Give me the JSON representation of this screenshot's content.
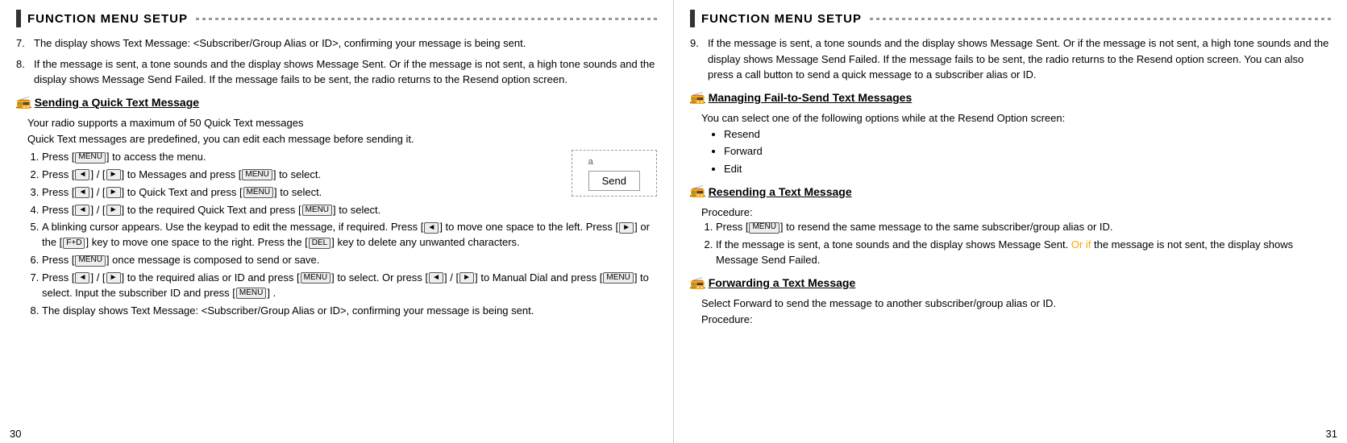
{
  "left_page": {
    "section_title": "FUNCTION MENU SETUP",
    "page_number": "30",
    "items_intro": [
      {
        "num": "7.",
        "text": "The display shows Text Message: <Subscriber/Group Alias or ID>, confirming your message is being sent."
      },
      {
        "num": "8.",
        "text": "If the message is sent, a tone sounds and the display shows Message Sent. Or if the message is not sent, a high tone sounds and the display shows Message Send Failed. If the message fails to be sent, the radio returns to the Resend option screen."
      }
    ],
    "subsection": {
      "title": "Sending a Quick Text Message",
      "intro1": "Your radio supports a maximum of 50 Quick Text messages",
      "intro2": "Quick Text messages are predefined, you can edit each message before sending it.",
      "steps": [
        "Press [MENU] to access the menu.",
        "Press [◄] / [►] to Messages and press [MENU] to select.",
        "Press [◄] / [►] to Quick Text and press [MENU] to select.",
        "Press [◄] / [►] to the required Quick Text and press [MENU] to select.",
        "A blinking cursor appears. Use the keypad to edit the message, if required. Press [◄] to move one space to the left. Press [►] or the [F+D] key to move one space to the right. Press the [DEL] key to delete any unwanted characters.",
        "Press [MENU] once message is composed to send or save.",
        "Press [◄] / [►] to the required alias or ID and press [MENU] to select. Or press [◄] / [►] to Manual Dial and press [MENU] to select. Input the subscriber ID and press [MENU].",
        "The display shows Text Message: <Subscriber/Group Alias or ID>, confirming your message is being sent."
      ],
      "send_box_label": "a",
      "send_box_text": "Send"
    }
  },
  "right_page": {
    "section_title": "FUNCTION MENU SETUP",
    "page_number": "31",
    "item_9": {
      "num": "9.",
      "text": "If the message is sent, a tone sounds and the display shows Message Sent. Or if the message is not sent, a high tone sounds and the display shows Message Send Failed. If the message fails to be sent, the radio returns to the Resend option screen. You can also press a call button to send a quick message to a subscriber alias or ID."
    },
    "subsections": [
      {
        "id": "managing",
        "title": "Managing Fail-to-Send Text Messages",
        "intro": "You can select one of the following options while at the Resend Option screen:",
        "bullets": [
          "Resend",
          "Forward",
          "Edit"
        ]
      },
      {
        "id": "resending",
        "title": "Resending a Text Message",
        "intro": "Procedure:",
        "steps": [
          "Press [MENU] to resend the same message to the same subscriber/group alias or ID.",
          "If the message is sent, a tone sounds and the display shows Message Sent. Or if the message is not sent, the display shows Message Send Failed."
        ],
        "orange_words": "Or if"
      },
      {
        "id": "forwarding",
        "title": "Forwarding a Text Message",
        "intro": "Select Forward to send the message to another subscriber/group alias or ID.\nProcedure:"
      }
    ]
  }
}
